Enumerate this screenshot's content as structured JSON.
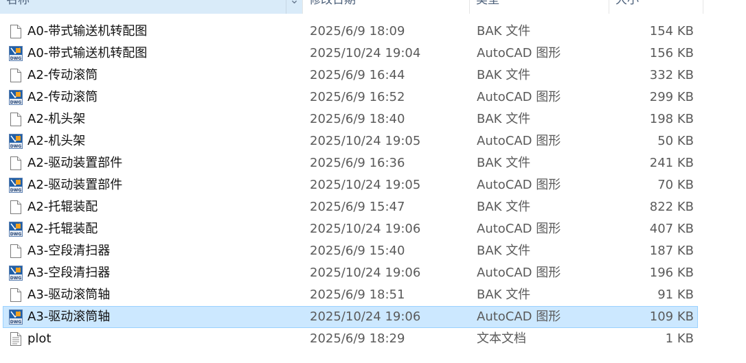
{
  "columns": {
    "name": "名称",
    "date": "修改日期",
    "type": "类型",
    "size": "大小"
  },
  "icons": {
    "generic": "generic-file-icon",
    "dwg": "dwg-file-icon",
    "text": "text-file-icon"
  },
  "colors": {
    "selected_bg": "#cce8ff",
    "selected_border": "#99d1ff",
    "dwg_blue": "#1f5fa8",
    "dwg_orange": "#f0a020"
  },
  "files": [
    {
      "name": "A0-带式输送机转配图",
      "date": "2025/6/9 18:09",
      "type": "BAK 文件",
      "size": "154 KB",
      "icon": "generic",
      "selected": false
    },
    {
      "name": "A0-带式输送机转配图",
      "date": "2025/10/24 19:04",
      "type": "AutoCAD 图形",
      "size": "156 KB",
      "icon": "dwg",
      "selected": false
    },
    {
      "name": "A2-传动滚筒",
      "date": "2025/6/9 16:44",
      "type": "BAK 文件",
      "size": "332 KB",
      "icon": "generic",
      "selected": false
    },
    {
      "name": "A2-传动滚筒",
      "date": "2025/6/9 16:52",
      "type": "AutoCAD 图形",
      "size": "299 KB",
      "icon": "dwg",
      "selected": false
    },
    {
      "name": "A2-机头架",
      "date": "2025/6/9 18:40",
      "type": "BAK 文件",
      "size": "198 KB",
      "icon": "generic",
      "selected": false
    },
    {
      "name": "A2-机头架",
      "date": "2025/10/24 19:05",
      "type": "AutoCAD 图形",
      "size": "50 KB",
      "icon": "dwg",
      "selected": false
    },
    {
      "name": "A2-驱动装置部件",
      "date": "2025/6/9 16:36",
      "type": "BAK 文件",
      "size": "241 KB",
      "icon": "generic",
      "selected": false
    },
    {
      "name": "A2-驱动装置部件",
      "date": "2025/10/24 19:05",
      "type": "AutoCAD 图形",
      "size": "70 KB",
      "icon": "dwg",
      "selected": false
    },
    {
      "name": "A2-托辊装配",
      "date": "2025/6/9 15:47",
      "type": "BAK 文件",
      "size": "822 KB",
      "icon": "generic",
      "selected": false
    },
    {
      "name": "A2-托辊装配",
      "date": "2025/10/24 19:06",
      "type": "AutoCAD 图形",
      "size": "407 KB",
      "icon": "dwg",
      "selected": false
    },
    {
      "name": "A3-空段清扫器",
      "date": "2025/6/9 15:40",
      "type": "BAK 文件",
      "size": "187 KB",
      "icon": "generic",
      "selected": false
    },
    {
      "name": "A3-空段清扫器",
      "date": "2025/10/24 19:06",
      "type": "AutoCAD 图形",
      "size": "196 KB",
      "icon": "dwg",
      "selected": false
    },
    {
      "name": "A3-驱动滚筒轴",
      "date": "2025/6/9 18:51",
      "type": "BAK 文件",
      "size": "91 KB",
      "icon": "generic",
      "selected": false
    },
    {
      "name": "A3-驱动滚筒轴",
      "date": "2025/10/24 19:06",
      "type": "AutoCAD 图形",
      "size": "109 KB",
      "icon": "dwg",
      "selected": true
    },
    {
      "name": "plot",
      "date": "2025/6/9 18:29",
      "type": "文本文档",
      "size": "1 KB",
      "icon": "text",
      "selected": false
    }
  ]
}
